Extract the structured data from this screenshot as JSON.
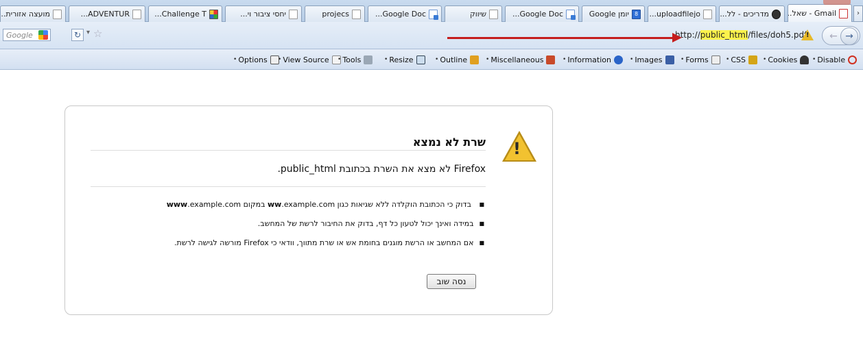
{
  "tabs": [
    {
      "label": "מועצה אזורית...",
      "icon": "doc-icon"
    },
    {
      "label": "ADVENTUR...",
      "icon": "doc-icon"
    },
    {
      "label": "Challenge T...",
      "icon": "joomla-icon"
    },
    {
      "label": "יחסי ציבור וי...",
      "icon": "doc-icon"
    },
    {
      "label": "projecs",
      "icon": "doc-icon"
    },
    {
      "label": "Google Doc...",
      "icon": "docs-icon"
    },
    {
      "label": "שיווק",
      "icon": "doc-icon"
    },
    {
      "label": "Google Doc...",
      "icon": "docs-icon"
    },
    {
      "label": "יומן Google",
      "icon": "calendar-icon",
      "badge": "8"
    },
    {
      "label": "uploadfilejo...",
      "icon": "doc-icon"
    },
    {
      "label": "מדריכים - לל...",
      "icon": "globe-icon"
    },
    {
      "label": "Gmail - שאל...",
      "icon": "gmail-icon"
    }
  ],
  "navbar": {
    "search_placeholder": "Google",
    "url_prefix": "http://",
    "url_highlight": "public_html",
    "url_suffix": "/files/doh5.pdf"
  },
  "devbar": [
    {
      "label": "Options",
      "icon": "options-icon"
    },
    {
      "label": "View Source",
      "icon": "view-source-icon"
    },
    {
      "label": "Tools",
      "icon": "tools-icon"
    },
    {
      "label": "Resize",
      "icon": "resize-icon"
    },
    {
      "label": "Outline",
      "icon": "outline-icon"
    },
    {
      "label": "Miscellaneous",
      "icon": "miscellaneous-icon"
    },
    {
      "label": "Information",
      "icon": "information-icon"
    },
    {
      "label": "Images",
      "icon": "images-icon"
    },
    {
      "label": "Forms",
      "icon": "forms-icon"
    },
    {
      "label": "CSS",
      "icon": "css-icon"
    },
    {
      "label": "Cookies",
      "icon": "cookies-icon"
    },
    {
      "label": "Disable",
      "icon": "disable-icon"
    }
  ],
  "error": {
    "title": "שרת לא נמצא",
    "description": "Firefox לא מצא את השרת בכתובת public_html.",
    "bullet1_text": "בדוק כי הכתובת הוקלדה ללא שגיאות כגון ",
    "bullet1_bold1": "ww",
    "bullet1_mid": ".example.com במקום ",
    "bullet1_bold2": "www",
    "bullet1_end": ".example.com",
    "bullet2": "במידה ואינך יכול לטעון כל דף, בדוק את החיבור לרשת של המחשב.",
    "bullet3": "אם המחשב או הרשת מוגנים בחומת אש או שרת מתווך, וודאי כי Firefox מורשה לגישה לרשת.",
    "try_again_label": "נסה שוב"
  },
  "colors": {
    "arrow": "#c51d1d",
    "url_highlight": "#fbf24b",
    "warning": "#f2c230"
  }
}
